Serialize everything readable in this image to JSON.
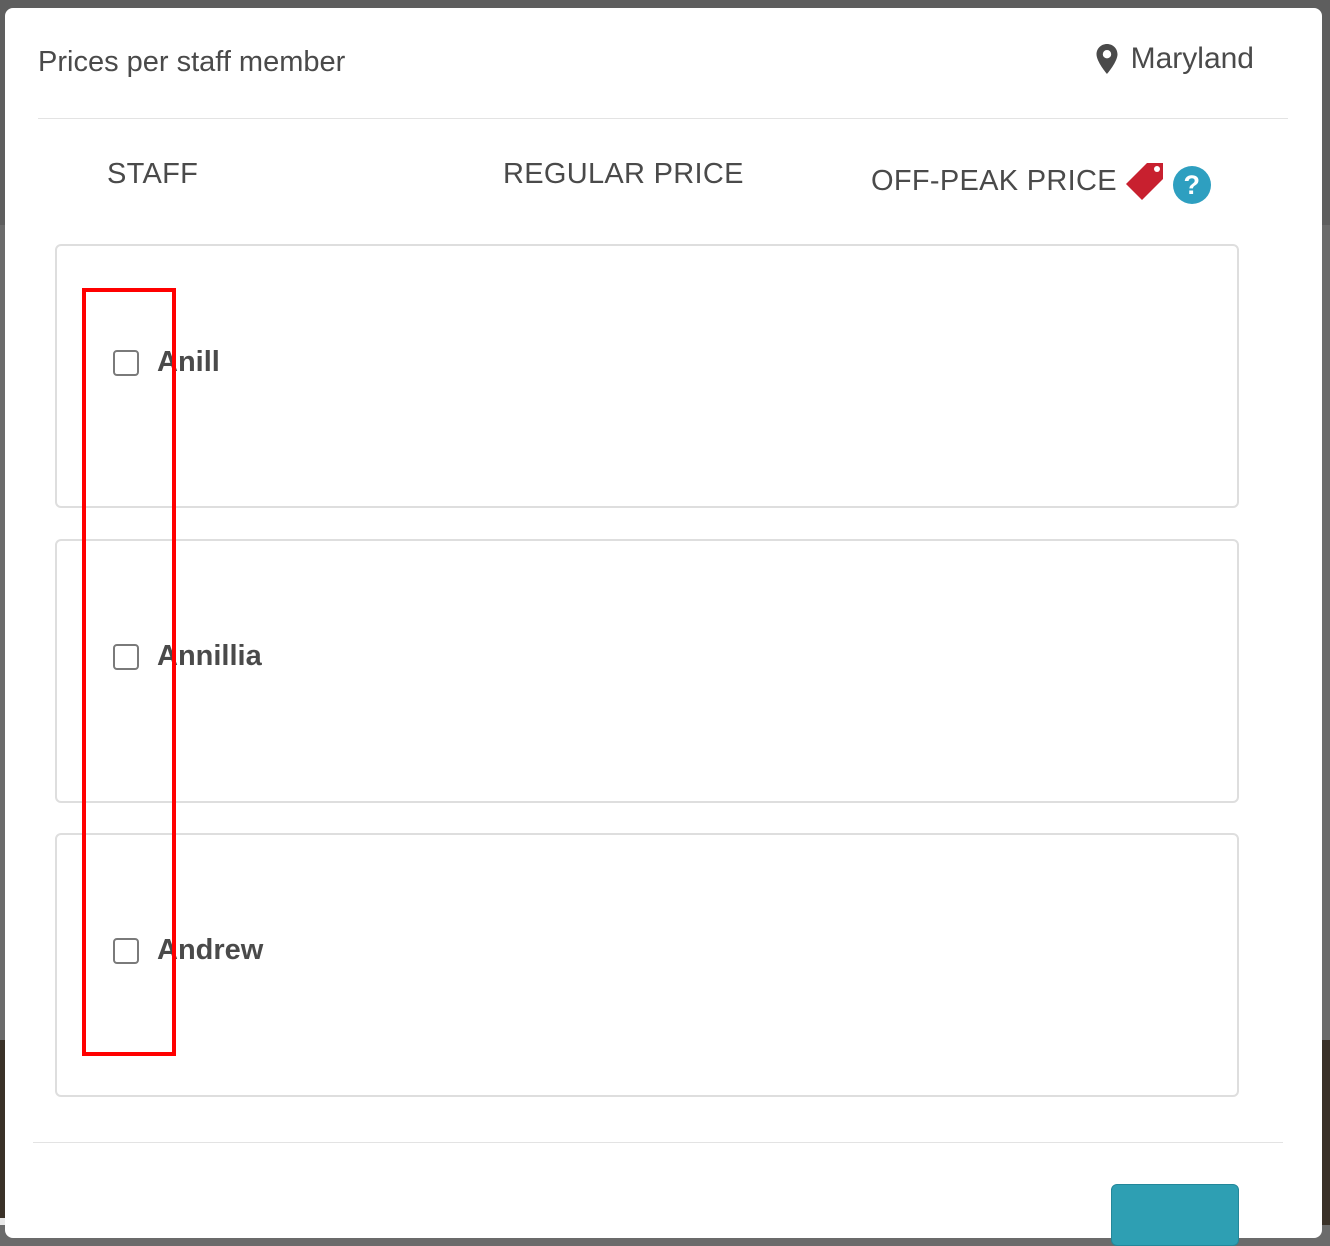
{
  "modal": {
    "title": "Prices per staff member",
    "location": "Maryland"
  },
  "columns": {
    "staff": "STAFF",
    "regular_price": "REGULAR PRICE",
    "off_peak_price": "OFF-PEAK PRICE"
  },
  "icons": {
    "location": "map-pin-icon",
    "off_peak": "price-tag-icon",
    "help": "question-mark-icon",
    "help_glyph": "?"
  },
  "colors": {
    "accent": "#2e9fc0",
    "tag": "#c8202f",
    "highlight": "#ff0000"
  },
  "staff": [
    {
      "name": "Anill",
      "checked": false
    },
    {
      "name": "Annillia",
      "checked": false
    },
    {
      "name": "Andrew",
      "checked": false
    }
  ]
}
